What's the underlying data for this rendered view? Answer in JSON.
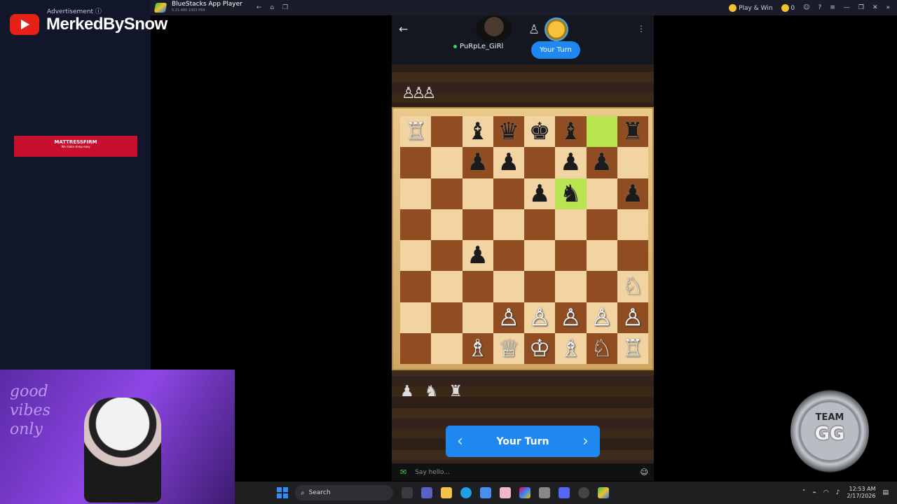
{
  "window": {
    "app_title": "BlueStacks App Player",
    "app_subtitle": "5.21.480.1003  P64",
    "nav_icons": [
      "back-icon",
      "home-icon",
      "multi-instance-icon"
    ],
    "play_win": "Play & Win",
    "coins": "0",
    "controls": [
      "avatar",
      "help-icon",
      "menu-icon",
      "minimize-icon",
      "restore-icon",
      "close-icon",
      "expand-icon"
    ]
  },
  "sidebar": {
    "ad_label": "Advertisement ⓘ",
    "channel_name": "MerkedBySnow",
    "ad_brand": "MATTRESSFIRM",
    "ad_tagline": "We make sleep easy"
  },
  "game": {
    "opponent_name": "PuRpLe_GiRl",
    "turn_pill": "Your Turn",
    "turn_button": "Your Turn",
    "chat_placeholder": "Say hello...",
    "captured_top": [
      "♙",
      "♙",
      "♙"
    ],
    "captured_bottom": [
      "♟",
      "♞",
      "♜"
    ],
    "highlight_squares": [
      "g8",
      "f6"
    ],
    "board": [
      [
        "R",
        "",
        "b",
        "q",
        "k",
        "b",
        "",
        "r"
      ],
      [
        "",
        "",
        "p",
        "p",
        "",
        "p",
        "p",
        ""
      ],
      [
        "",
        "",
        "",
        "",
        "p",
        "n",
        "",
        "p"
      ],
      [
        "",
        "",
        "",
        "",
        "",
        "",
        "",
        ""
      ],
      [
        "",
        "",
        "p",
        "",
        "",
        "",
        "",
        ""
      ],
      [
        "",
        "",
        "",
        "",
        "",
        "",
        "",
        "N"
      ],
      [
        "",
        "",
        "",
        "P",
        "P",
        "P",
        "P",
        "P"
      ],
      [
        "",
        "",
        "B",
        "Q",
        "K",
        "B",
        "N",
        "R"
      ]
    ]
  },
  "overlay": {
    "neon_text": [
      "good",
      "vibes",
      "only"
    ],
    "team_top": "TEAM",
    "team_bottom": "GG"
  },
  "taskbar": {
    "search_label": "Search",
    "time": "12:53 AM",
    "date": "2/17/2026"
  }
}
